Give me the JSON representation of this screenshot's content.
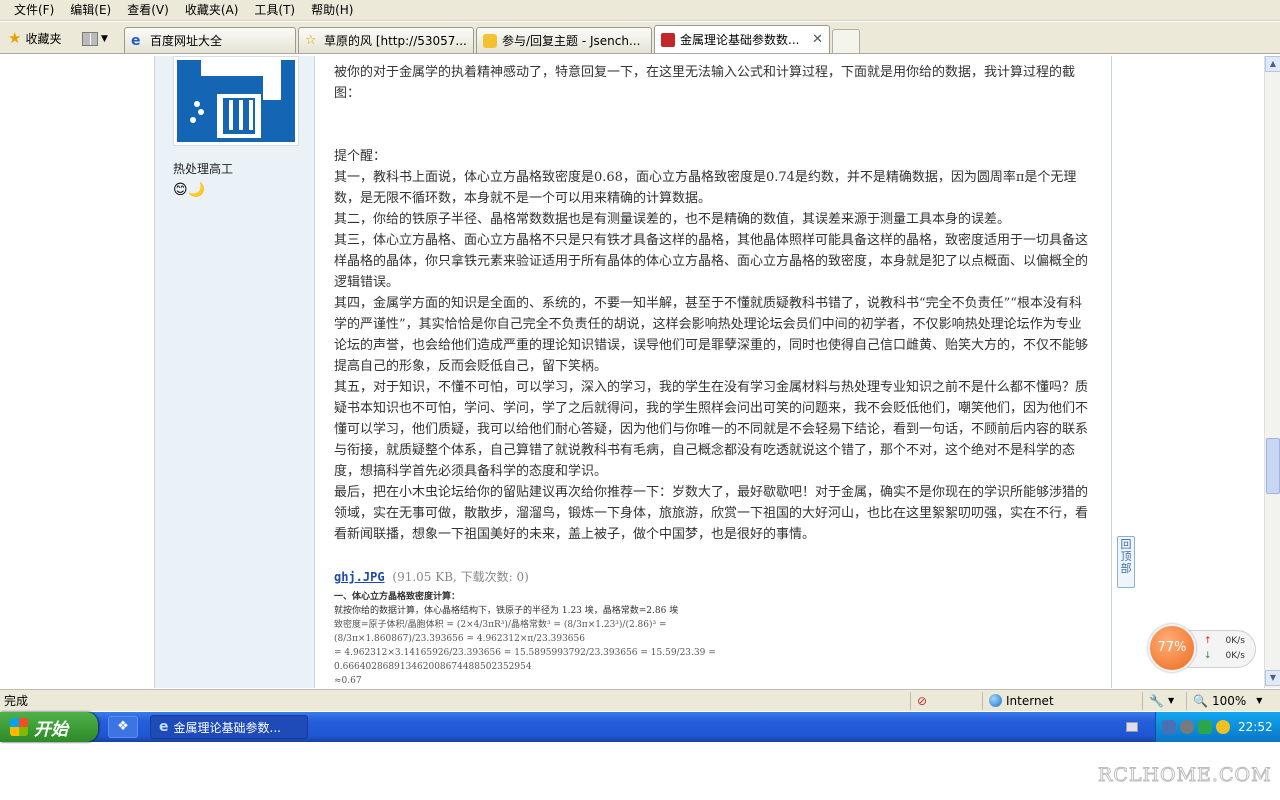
{
  "menu": [
    "文件(F)",
    "编辑(E)",
    "查看(V)",
    "收藏夹(A)",
    "工具(T)",
    "帮助(H)"
  ],
  "favorites_label": "收藏夹",
  "tabs": [
    {
      "title": "百度网址大全",
      "icon": "ie-icon"
    },
    {
      "title": "草原的风 [http://53057...",
      "icon": "star-icon"
    },
    {
      "title": "参与/回复主题 - Jsench...",
      "icon": "chat-icon"
    },
    {
      "title": "金属理论基础参数数...",
      "icon": "forum-icon",
      "active": true
    }
  ],
  "sidebar": {
    "user_title": "热处理高工",
    "emoticons": "😊🌙"
  },
  "post": {
    "paragraphs": [
      "被你的对于金属学的执着精神感动了，特意回复一下，在这里无法输入公式和计算过程，下面就是用你给的数据，我计算过程的截图：",
      "",
      "提个醒：",
      "其一，教科书上面说，体心立方晶格致密度是0.68，面心立方晶格致密度是0.74是约数，并不是精确数据，因为圆周率π是个无理数，是无限不循环数，本身就不是一个可以用来精确的计算数据。",
      "其二，你给的铁原子半径、晶格常数数据也是有测量误差的，也不是精确的数值，其误差来源于测量工具本身的误差。",
      "其三，体心立方晶格、面心立方晶格不只是只有铁才具备这样的晶格，其他晶体照样可能具备这样的晶格，致密度适用于一切具备这样晶格的晶体，你只拿铁元素来验证适用于所有晶体的体心立方晶格、面心立方晶格的致密度，本身就是犯了以点概面、以偏概全的逻辑错误。",
      "其四，金属学方面的知识是全面的、系统的，不要一知半解，甚至于不懂就质疑教科书错了，说教科书“完全不负责任”“根本没有科学的严谨性”，其实恰恰是你自己完全不负责任的胡说，这样会影响热处理论坛会员们中间的初学者，不仅影响热处理论坛作为专业论坛的声誉，也会给他们造成严重的理论知识错误，误导他们可是罪孽深重的，同时也使得自己信口雌黄、贻笑大方的，不仅不能够提高自己的形象，反而会贬低自己，留下笑柄。",
      "其五，对于知识，不懂不可怕，可以学习，深入的学习，我的学生在没有学习金属材料与热处理专业知识之前不是什么都不懂吗？质疑书本知识也不可怕，学问、学问，学了之后就得问，我的学生照样会问出可笑的问题来，我不会贬低他们，嘲笑他们，因为他们不懂可以学习，他们质疑，我可以给他们耐心答疑，因为他们与你唯一的不同就是不会轻易下结论，看到一句话，不顾前后内容的联系与衔接，就质疑整个体系，自己算错了就说教科书有毛病，自己概念都没有吃透就说这个错了，那个不对，这个绝对不是科学的态度，想搞科学首先必须具备科学的态度和学识。",
      "最后，把在小木虫论坛给你的留贴建议再次给你推荐一下：岁数大了，最好歇歇吧！对于金属，确实不是你现在的学识所能够涉猎的领域，实在无事可做，散散步，溜溜鸟，锻炼一下身体，旅旅游，欣赏一下祖国的大好河山，也比在这里絮絮叨叨强，实在不行，看看新闻联播，想象一下祖国美好的未来，盖上被子，做个中国梦，也是很好的事情。"
    ],
    "attachment": {
      "name": "ghj.JPG",
      "meta": "(91.05 KB, 下载次数: 0)"
    },
    "formula_image": {
      "heading": "一、体心立方晶格致密度计算：",
      "line1": "就按你给的数据计算，体心晶格结构下，铁原子的半径为 1.23 埃，晶格常数=2.86 埃",
      "line2": "致密度=原子体积/晶胞体积 = (2×4/3πR³)/晶格常数³ = (8/3π×1.23³)/(2.86)³ = (8/3π×1.860867)/23.393656 = 4.962312×π/23.393656",
      "line3": "= 4.962312×3.14165926/23.393656 = 15.5895993792/23.393656 = 15.59/23.39 = 0.666402868913462008674488502352954",
      "line4": "≈0.67"
    },
    "back_to_top": "回顶部"
  },
  "speed_widget": {
    "percent": "77%",
    "upload": "0K/s",
    "download": "0K/s"
  },
  "statusbar": {
    "status": "完成",
    "zone": "Internet",
    "zoom": "100%"
  },
  "taskbar": {
    "start_label": "开始",
    "task_title": "金属理论基础参数...",
    "clock": "22:52"
  },
  "watermark": "RCLHOME.COM"
}
